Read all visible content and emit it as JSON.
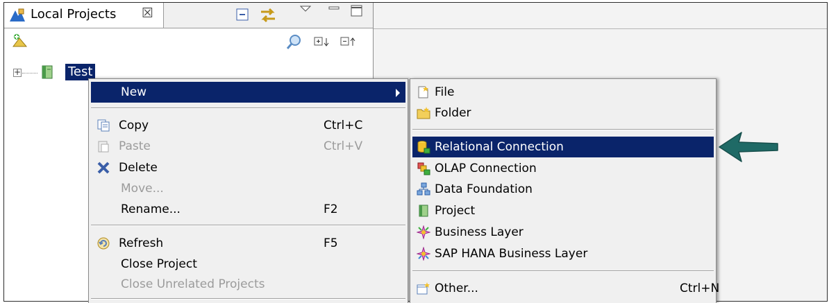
{
  "view": {
    "tab_label": "Local Projects",
    "tab_close": "☒",
    "tree": {
      "expander": "+",
      "project_label": "Test"
    }
  },
  "context_menu": {
    "items": [
      {
        "label": "New",
        "shortcut": "",
        "icon": "none",
        "enabled": true,
        "selected": true,
        "has_submenu": true
      },
      {
        "label": "Copy",
        "shortcut": "Ctrl+C",
        "icon": "copy-icon",
        "enabled": true
      },
      {
        "label": "Paste",
        "shortcut": "Ctrl+V",
        "icon": "paste-icon",
        "enabled": false
      },
      {
        "label": "Delete",
        "shortcut": "",
        "icon": "delete-icon",
        "enabled": true
      },
      {
        "label": "Move...",
        "shortcut": "",
        "icon": "none",
        "enabled": false
      },
      {
        "label": "Rename...",
        "shortcut": "F2",
        "icon": "none",
        "enabled": true
      },
      {
        "label": "Refresh",
        "shortcut": "F5",
        "icon": "refresh-icon",
        "enabled": true
      },
      {
        "label": "Close Project",
        "shortcut": "",
        "icon": "none",
        "enabled": true
      },
      {
        "label": "Close Unrelated Projects",
        "shortcut": "",
        "icon": "none",
        "enabled": false
      }
    ]
  },
  "submenu": {
    "items": [
      {
        "label": "File",
        "shortcut": "",
        "icon": "new-file-icon"
      },
      {
        "label": "Folder",
        "shortcut": "",
        "icon": "new-folder-icon"
      },
      {
        "label": "Relational Connection",
        "shortcut": "",
        "icon": "relational-connection-icon",
        "selected": true
      },
      {
        "label": "OLAP Connection",
        "shortcut": "",
        "icon": "olap-connection-icon"
      },
      {
        "label": "Data Foundation",
        "shortcut": "",
        "icon": "data-foundation-icon"
      },
      {
        "label": "Project",
        "shortcut": "",
        "icon": "project-icon"
      },
      {
        "label": "Business Layer",
        "shortcut": "",
        "icon": "business-layer-icon"
      },
      {
        "label": "SAP HANA Business Layer",
        "shortcut": "",
        "icon": "sap-hana-business-layer-icon"
      },
      {
        "label": "Other...",
        "shortcut": "Ctrl+N",
        "icon": "other-wizard-icon"
      }
    ]
  },
  "colors": {
    "selection": "#0a246a",
    "menu_bg": "#f0f0f0",
    "disabled_text": "#9b9b9b",
    "pointer_arrow": "#1f6a66"
  }
}
